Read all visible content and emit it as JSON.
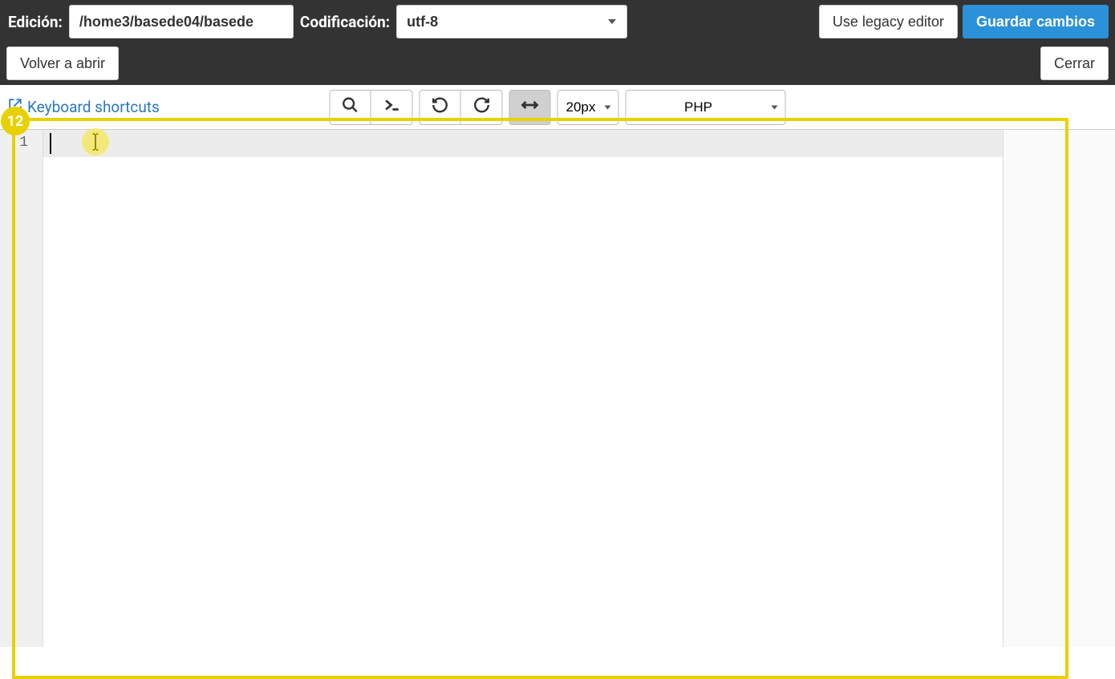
{
  "topbar": {
    "edit_label": "Edición:",
    "path_value": "/home3/basede04/basede",
    "encoding_label": "Codificación:",
    "encoding_value": "utf-8",
    "legacy_label": "Use legacy editor",
    "save_label": "Guardar cambios",
    "reopen_label": "Volver a abrir",
    "close_label": "Cerrar"
  },
  "toolbar": {
    "kb_shortcuts_label": "Keyboard shortcuts",
    "fontsize_value": "20px",
    "language_value": "PHP"
  },
  "editor": {
    "line_numbers": [
      "1"
    ]
  },
  "annotation": {
    "step_badge": "12"
  }
}
